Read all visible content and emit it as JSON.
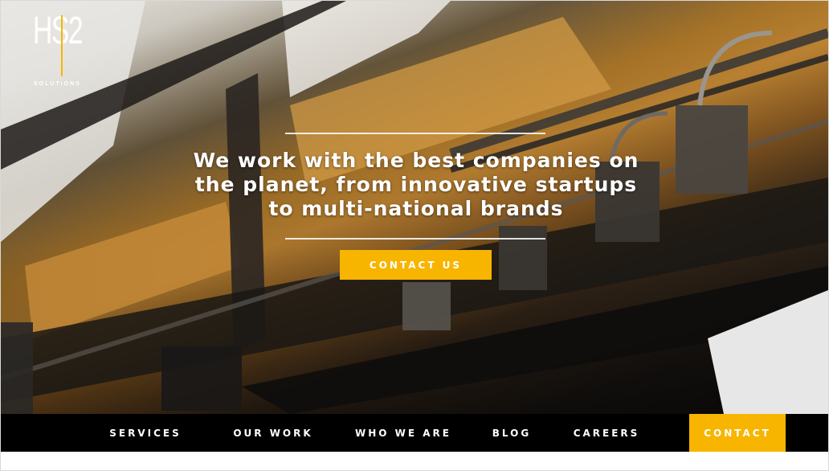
{
  "brand": {
    "logo_mark": "HS2",
    "logo_sub": "SOLUTIONS",
    "accent": "#f7b500"
  },
  "hero": {
    "headline": "We work with the best companies on the planet, from innovative startups to multi-national brands",
    "cta_label": "CONTACT US"
  },
  "nav": {
    "items": [
      {
        "label": "SERVICES"
      },
      {
        "label": "OUR WORK"
      },
      {
        "label": "WHO WE ARE"
      },
      {
        "label": "BLOG"
      },
      {
        "label": "CAREERS"
      },
      {
        "label": "CONTACT"
      }
    ],
    "active": "CONTACT"
  }
}
